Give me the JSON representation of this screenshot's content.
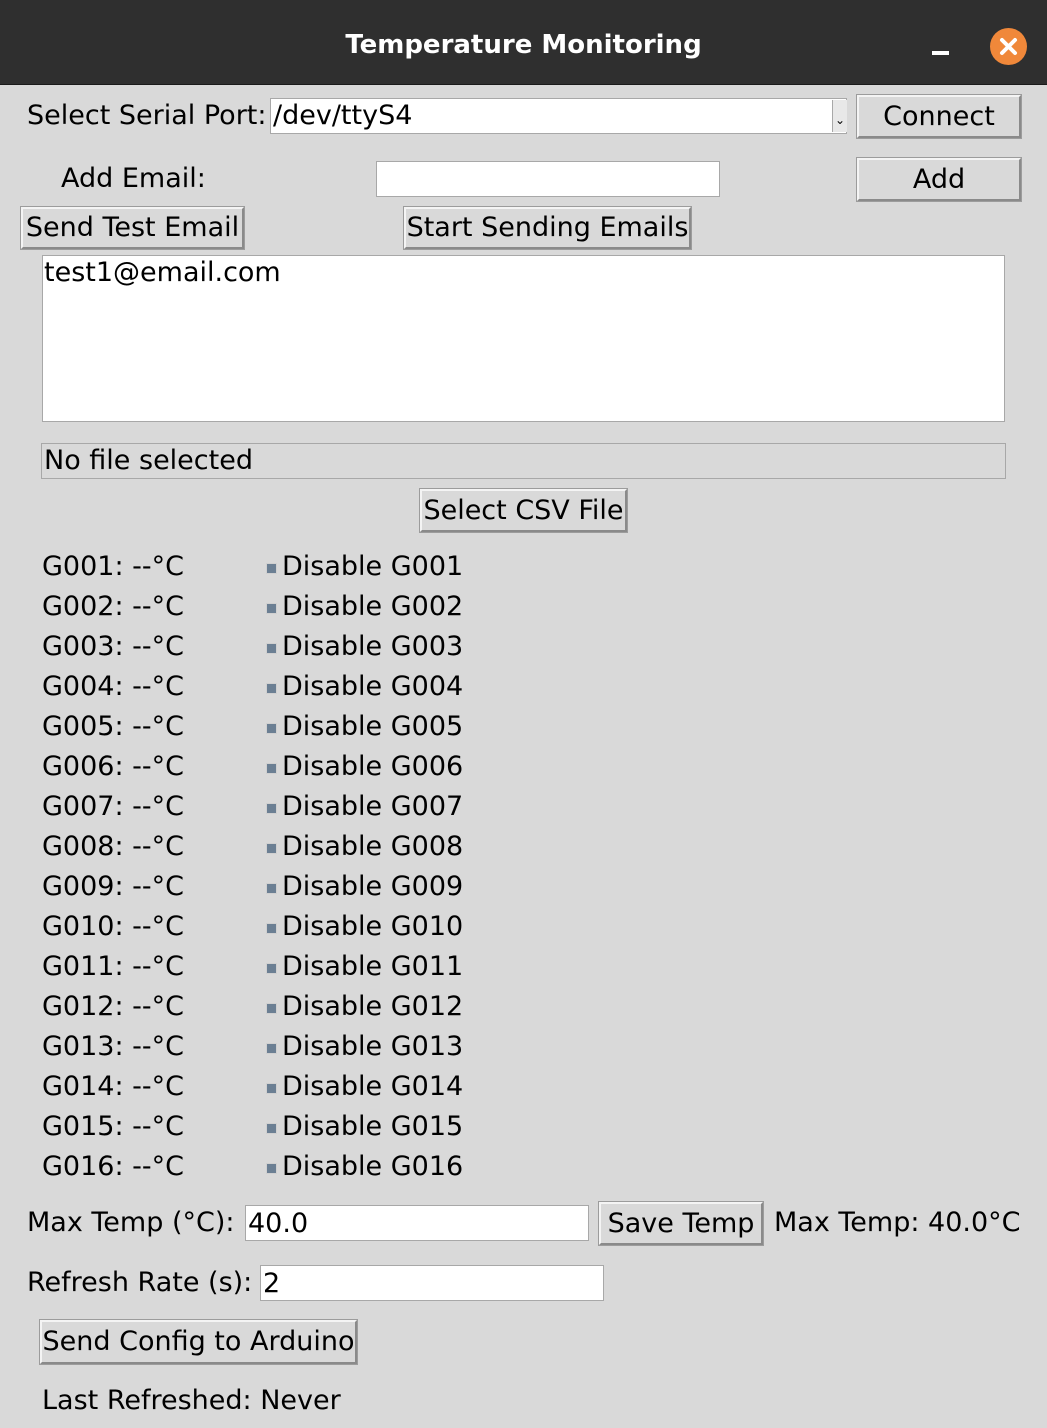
{
  "window": {
    "title": "Temperature Monitoring"
  },
  "serial": {
    "label": "Select Serial Port:",
    "selected": "/dev/ttyS4",
    "connect_label": "Connect"
  },
  "email": {
    "label": "Add Email:",
    "value": "",
    "add_label": "Add",
    "send_test_label": "Send Test Email",
    "start_sending_label": "Start Sending Emails",
    "list": [
      "test1@email.com"
    ]
  },
  "file": {
    "status": "No file selected",
    "select_label": "Select CSV File"
  },
  "sensors": [
    {
      "temp": "G001: --°C",
      "checkbox": "Disable G001"
    },
    {
      "temp": "G002: --°C",
      "checkbox": "Disable G002"
    },
    {
      "temp": "G003: --°C",
      "checkbox": "Disable G003"
    },
    {
      "temp": "G004: --°C",
      "checkbox": "Disable G004"
    },
    {
      "temp": "G005: --°C",
      "checkbox": "Disable G005"
    },
    {
      "temp": "G006: --°C",
      "checkbox": "Disable G006"
    },
    {
      "temp": "G007: --°C",
      "checkbox": "Disable G007"
    },
    {
      "temp": "G008: --°C",
      "checkbox": "Disable G008"
    },
    {
      "temp": "G009: --°C",
      "checkbox": "Disable G009"
    },
    {
      "temp": "G010: --°C",
      "checkbox": "Disable G010"
    },
    {
      "temp": "G011: --°C",
      "checkbox": "Disable G011"
    },
    {
      "temp": "G012: --°C",
      "checkbox": "Disable G012"
    },
    {
      "temp": "G013: --°C",
      "checkbox": "Disable G013"
    },
    {
      "temp": "G014: --°C",
      "checkbox": "Disable G014"
    },
    {
      "temp": "G015: --°C",
      "checkbox": "Disable G015"
    },
    {
      "temp": "G016: --°C",
      "checkbox": "Disable G016"
    }
  ],
  "max_temp": {
    "label": "Max Temp (°C):",
    "value": "40.0",
    "save_label": "Save Temp",
    "display": "Max Temp: 40.0°C"
  },
  "refresh": {
    "label": "Refresh Rate (s):",
    "value": "2"
  },
  "arduino": {
    "send_config_label": "Send Config to Arduino"
  },
  "status": {
    "last_refreshed": "Last Refreshed: Never"
  },
  "colors": {
    "titlebar": "#2f2f2f",
    "background": "#d9d9d9",
    "close_button": "#f0883a",
    "checkbox": "#6b7f93"
  },
  "icons": {
    "minimize": "minimize-icon",
    "close": "close-icon",
    "dropdown": "chevron-down-icon"
  }
}
